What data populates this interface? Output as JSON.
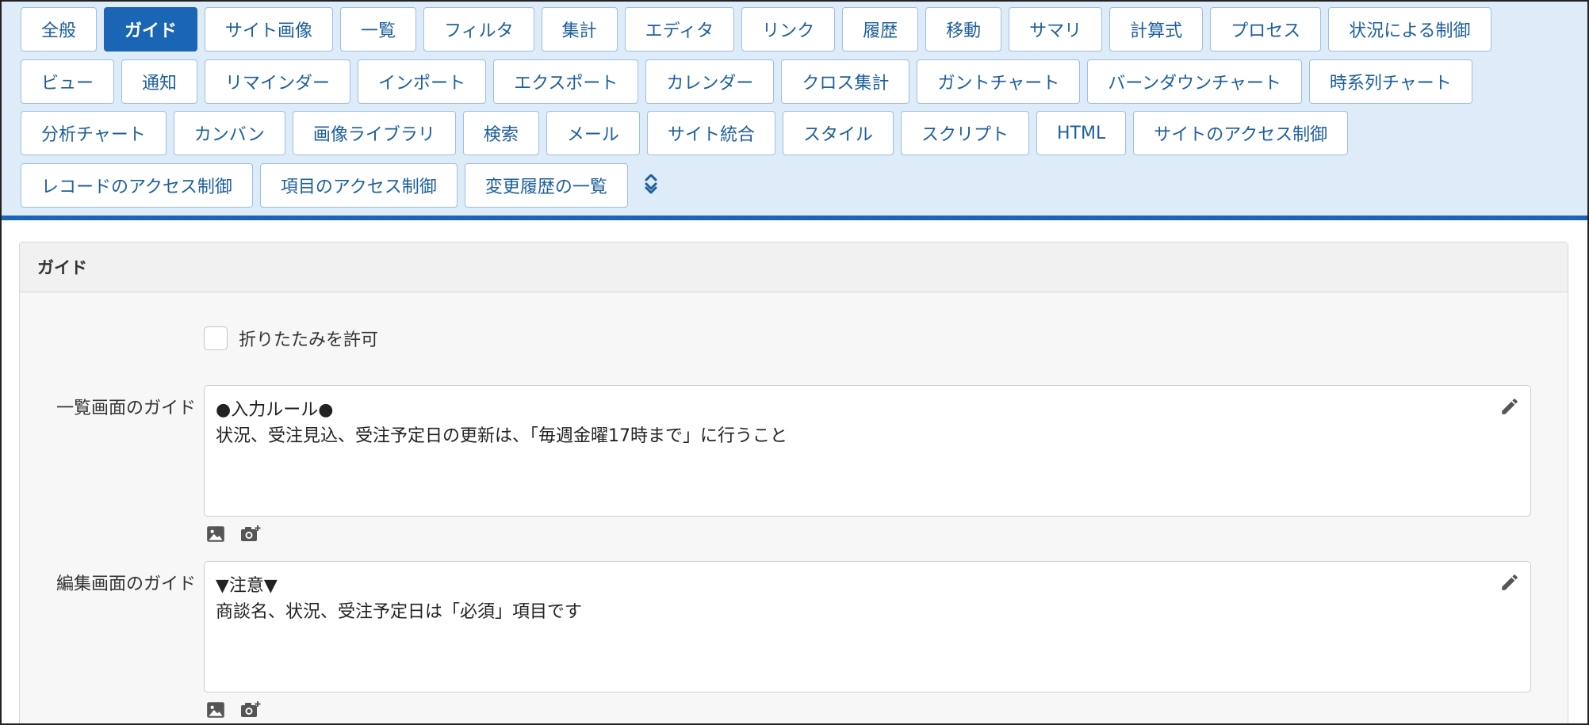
{
  "tabs": {
    "row1": [
      {
        "label": "全般"
      },
      {
        "label": "ガイド"
      },
      {
        "label": "サイト画像"
      },
      {
        "label": "一覧"
      },
      {
        "label": "フィルタ"
      },
      {
        "label": "集計"
      },
      {
        "label": "エディタ"
      },
      {
        "label": "リンク"
      },
      {
        "label": "履歴"
      },
      {
        "label": "移動"
      },
      {
        "label": "サマリ"
      },
      {
        "label": "計算式"
      },
      {
        "label": "プロセス"
      },
      {
        "label": "状況による制御"
      }
    ],
    "row2": [
      {
        "label": "ビュー"
      },
      {
        "label": "通知"
      },
      {
        "label": "リマインダー"
      },
      {
        "label": "インポート"
      },
      {
        "label": "エクスポート"
      },
      {
        "label": "カレンダー"
      },
      {
        "label": "クロス集計"
      },
      {
        "label": "ガントチャート"
      },
      {
        "label": "バーンダウンチャート"
      },
      {
        "label": "時系列チャート"
      }
    ],
    "row3": [
      {
        "label": "分析チャート"
      },
      {
        "label": "カンバン"
      },
      {
        "label": "画像ライブラリ"
      },
      {
        "label": "検索"
      },
      {
        "label": "メール"
      },
      {
        "label": "サイト統合"
      },
      {
        "label": "スタイル"
      },
      {
        "label": "スクリプト"
      },
      {
        "label": "HTML"
      },
      {
        "label": "サイトのアクセス制御"
      }
    ],
    "row4": [
      {
        "label": "レコードのアクセス制御"
      },
      {
        "label": "項目のアクセス制御"
      },
      {
        "label": "変更履歴の一覧"
      }
    ],
    "active": "ガイド",
    "collapse_icon": "double-chevron-up-icon"
  },
  "panel": {
    "title": "ガイド",
    "allow_collapse_label": "折りたたみを許可",
    "allow_collapse_checked": false,
    "index_guide": {
      "label": "一覧画面のガイド",
      "lines": [
        "●入力ルール●",
        "状況、受注見込、受注予定日の更新は、「毎週金曜17時まで」に行うこと"
      ]
    },
    "edit_guide": {
      "label": "編集画面のガイド",
      "lines": [
        "▼注意▼",
        "商談名、状況、受注予定日は「必須」項目です"
      ]
    },
    "icons": {
      "edit": "pencil-icon",
      "image": "image-icon",
      "camera": "camera-icon"
    }
  },
  "colors": {
    "tab_area_bg": "#deebf8",
    "accent": "#1a66b5",
    "tab_text": "#1d5e9e",
    "panel_bg": "#f7f7f7"
  }
}
